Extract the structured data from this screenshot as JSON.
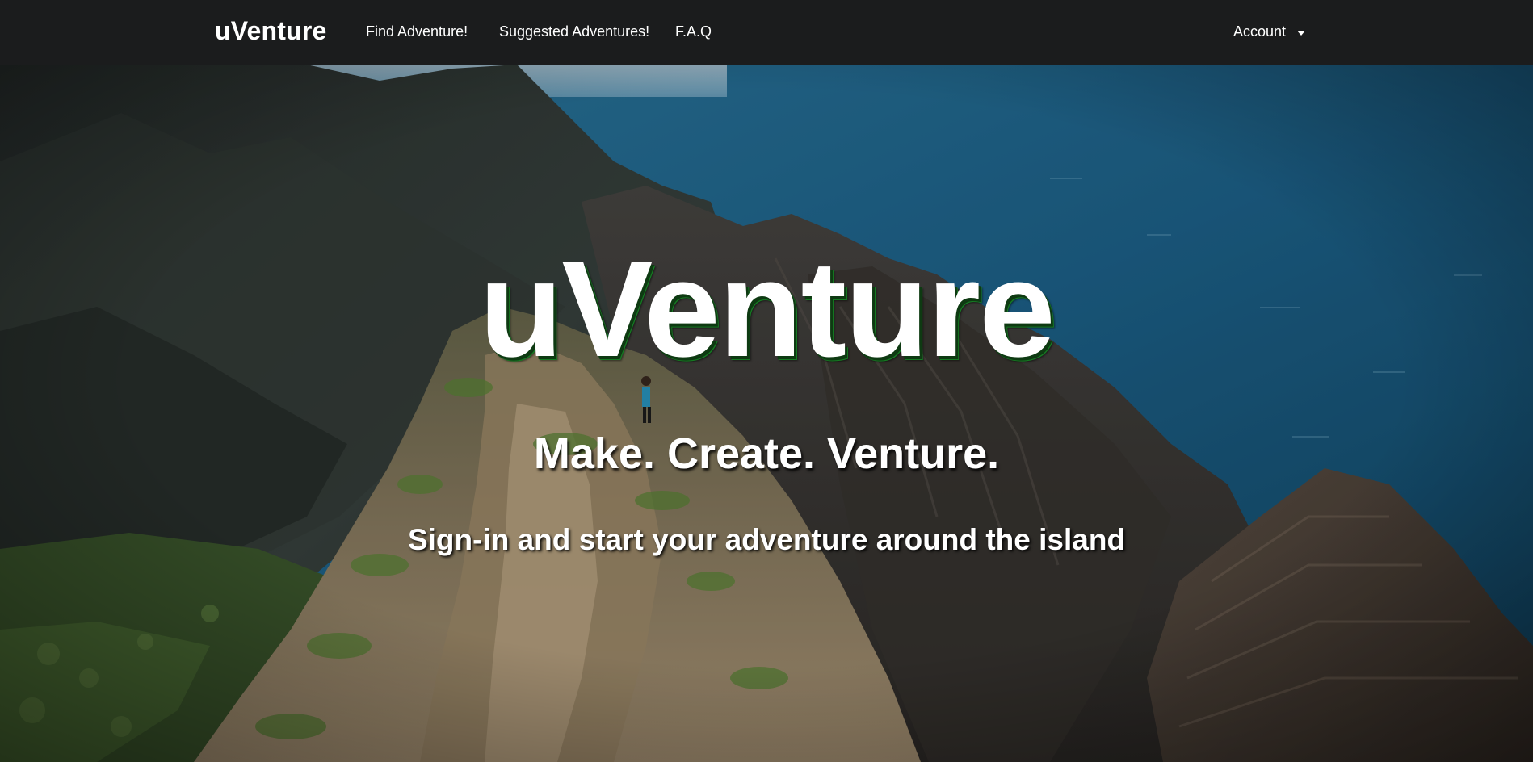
{
  "navbar": {
    "brand": "uVenture",
    "items": [
      {
        "label": "Find Adventure!"
      },
      {
        "label": "Suggested Adventures!"
      },
      {
        "label": "F.A.Q"
      }
    ],
    "account_label": "Account"
  },
  "hero": {
    "title": "uVenture",
    "tagline": "Make. Create. Venture.",
    "cta": "Sign-in and start your adventure around the island"
  },
  "colors": {
    "navbar_bg": "#1b1c1d",
    "nav_text": "#ffffff",
    "title_shadow": "#157a22",
    "ocean": "#1f5f85"
  },
  "icons": {
    "account_caret": "caret-down-icon"
  }
}
